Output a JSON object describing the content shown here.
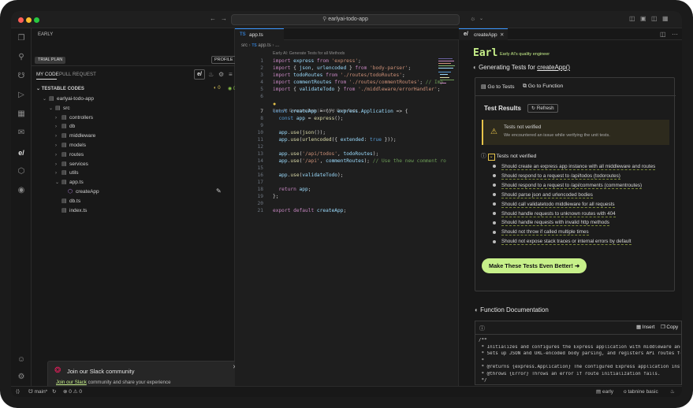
{
  "window": {
    "search": "earlyai-todo-app"
  },
  "sidebar": {
    "section": "EARLY",
    "trial_plan": "TRIAL PLAN",
    "profile": "PROFILE",
    "tabs": [
      "MY CODE",
      "PULL REQUEST"
    ],
    "testable_header": "TESTABLE CODES",
    "counts": {
      "a": "0",
      "b": "0"
    },
    "tree": [
      {
        "label": "earlyai-todo-app",
        "depth": 0,
        "type": "root"
      },
      {
        "label": "src",
        "depth": 1,
        "type": "folder-open"
      },
      {
        "label": "controllers",
        "depth": 2,
        "type": "folder"
      },
      {
        "label": "db",
        "depth": 2,
        "type": "folder"
      },
      {
        "label": "middleware",
        "depth": 2,
        "type": "folder"
      },
      {
        "label": "models",
        "depth": 2,
        "type": "folder"
      },
      {
        "label": "routes",
        "depth": 2,
        "type": "folder"
      },
      {
        "label": "services",
        "depth": 2,
        "type": "folder"
      },
      {
        "label": "utils",
        "depth": 2,
        "type": "folder"
      },
      {
        "label": "app.ts",
        "depth": 2,
        "type": "file-open"
      },
      {
        "label": "createApp",
        "depth": 3,
        "type": "function"
      },
      {
        "label": "db.ts",
        "depth": 2,
        "type": "file"
      },
      {
        "label": "index.ts",
        "depth": 2,
        "type": "file"
      }
    ],
    "slack": {
      "title": "Join our Slack community",
      "link": "Join our Slack",
      "rest": "community and share your experience"
    }
  },
  "editor": {
    "tab": "app.ts",
    "breadcrumb": [
      "src",
      "app.ts",
      "..."
    ],
    "codelens_top": "Early AI: Generate Tests for all Methods",
    "codelens_mid": "Early AI: Generate Tests | Early AI: Go to Tests",
    "lines": [
      {
        "n": "1",
        "code": "import express from 'express';"
      },
      {
        "n": "2",
        "code": "import { json, urlencoded } from 'body-parser';"
      },
      {
        "n": "3",
        "code": "import todoRoutes from './routes/todoRoutes';"
      },
      {
        "n": "4",
        "code": "import commentRoutes from './routes/commentRoutes'; // Imp"
      },
      {
        "n": "5",
        "code": "import { validateTodo } from './middleware/errorHandler';"
      },
      {
        "n": "6",
        "code": ""
      },
      {
        "n": "7",
        "code": "const createApp = (): express.Application => {"
      },
      {
        "n": "8",
        "code": "  const app = express();"
      },
      {
        "n": "9",
        "code": ""
      },
      {
        "n": "10",
        "code": "  app.use(json());"
      },
      {
        "n": "11",
        "code": "  app.use(urlencoded({ extended: true }));"
      },
      {
        "n": "12",
        "code": ""
      },
      {
        "n": "13",
        "code": "  app.use('/api/todos', todoRoutes);"
      },
      {
        "n": "14",
        "code": "  app.use('/api', commentRoutes); // Use the new comment ro"
      },
      {
        "n": "15",
        "code": ""
      },
      {
        "n": "16",
        "code": "  app.use(validateTodo);"
      },
      {
        "n": "17",
        "code": ""
      },
      {
        "n": "18",
        "code": "  return app;"
      },
      {
        "n": "19",
        "code": "};"
      },
      {
        "n": "20",
        "code": ""
      },
      {
        "n": "21",
        "code": "export default createApp;"
      }
    ]
  },
  "panel": {
    "tab": "createApp",
    "brand": "Earl",
    "brand_sub": "Early AI's quality engineer",
    "generating_prefix": "Generating Tests for",
    "generating_target": "createApp()",
    "go_to_tests": "Go to Tests",
    "go_to_function": "Go to Function",
    "results_title": "Test Results",
    "refresh": "Refresh",
    "warning_title": "Tests not verified",
    "warning_body": "We encountered an issue while verifying the unit tests.",
    "group_title": "Tests not verified",
    "tests": [
      "Should create an express app instance with all middleware and routes",
      "Should respond to a request to /api/todos (todoroutes)",
      "Should respond to a request to /api/comments (commentroutes)",
      "Should parse json and urlencoded bodies",
      "Should call validatetodo middleware for all requests",
      "Should handle requests to unknown routes with 404",
      "Should handle requests with invalid http methods",
      "Should not throw if called multiple times",
      "Should not expose stack traces or internal errors by default"
    ],
    "cta": "Make These Tests Even Better!",
    "doc_title": "Function Documentation",
    "insert": "Insert",
    "copy": "Copy",
    "doc_lines": [
      "/**",
      " * Initializes and configures the Express application with middleware and",
      " * Sets up JSON and URL-encoded body parsing, and registers API routes fo",
      " *",
      " * @returns {express.Application} The configured Express application inst",
      " * @throws {Error} Throws an error if route initialization fails.",
      " */"
    ]
  },
  "status": {
    "branch": "main*",
    "errors": "0",
    "warnings": "0",
    "early": "early",
    "tabnine": "tabnine basic"
  },
  "colors": {
    "accent_green": "#c7f08a",
    "warning": "#e7c44a",
    "background": "#181818"
  }
}
